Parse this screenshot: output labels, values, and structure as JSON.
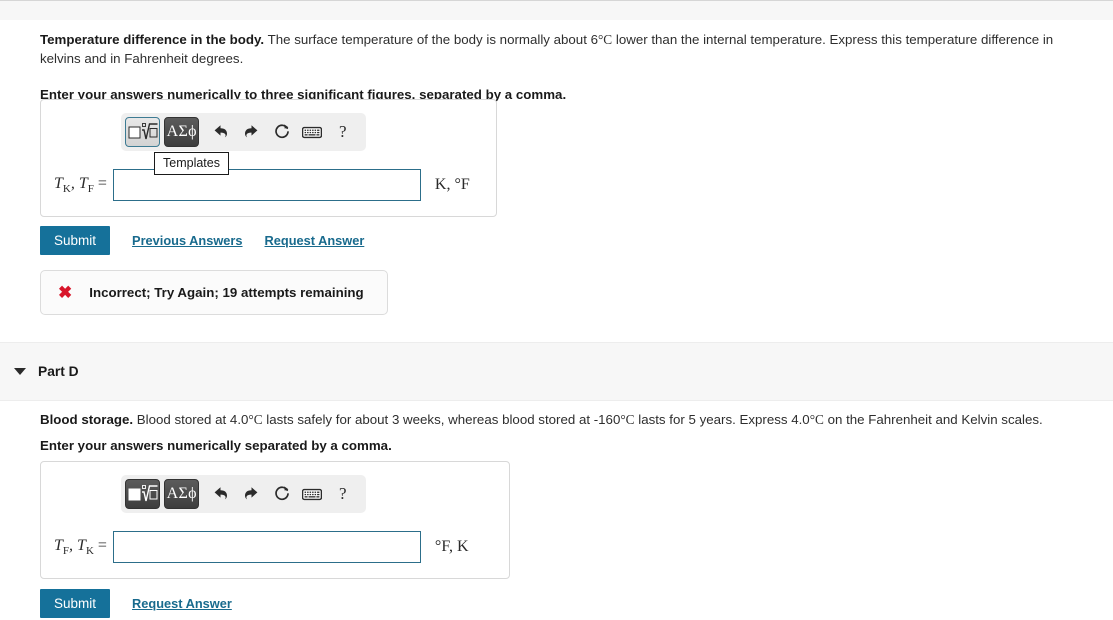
{
  "part_c": {
    "prompt_title": "Temperature difference in the body.",
    "prompt_text_1": "The surface temperature of the body is normally about 6",
    "prompt_deg_1": "°C",
    "prompt_text_2": " lower than the internal temperature. Express this temperature difference in kelvins and in Fahrenheit degrees.",
    "instruction": "Enter your answers numerically to three significant figures, separated by a comma.",
    "toolbar": {
      "templates_label": "templates-button",
      "greek_label": "ΑΣϕ",
      "undo_label": "undo",
      "redo_label": "redo",
      "reset_label": "reset",
      "keyboard_label": "keyboard",
      "help_label": "?"
    },
    "tooltip": "Templates",
    "answer_label_var1": "T",
    "answer_label_sub1": "K",
    "answer_label_var2": "T",
    "answer_label_sub2": "F",
    "answer_label_eq": "=",
    "answer_value": "",
    "answer_placeholder": "",
    "units": "K, °F",
    "submit_label": "Submit",
    "previous_answers_label": "Previous Answers",
    "request_answer_label": "Request Answer",
    "feedback_icon": "✖",
    "feedback_message": "Incorrect; Try Again; 19 attempts remaining"
  },
  "part_d": {
    "header_title": "Part D",
    "prompt_title": "Blood storage.",
    "prompt_text_1": "Blood stored at 4.0",
    "prompt_deg_1": "°C",
    "prompt_text_2": " lasts safely for about 3 weeks, whereas blood stored at -160",
    "prompt_deg_2": "°C",
    "prompt_text_3": " lasts for 5 years. Express 4.0",
    "prompt_deg_3": "°C",
    "prompt_text_4": " on the Fahrenheit and Kelvin scales.",
    "instruction": "Enter your answers numerically separated by a comma.",
    "toolbar": {
      "templates_label": "templates-button",
      "greek_label": "ΑΣϕ",
      "undo_label": "undo",
      "redo_label": "redo",
      "reset_label": "reset",
      "keyboard_label": "keyboard",
      "help_label": "?"
    },
    "answer_label_var1": "T",
    "answer_label_sub1": "F",
    "answer_label_var2": "T",
    "answer_label_sub2": "K",
    "answer_label_eq": "=",
    "answer_value": "",
    "answer_placeholder": "",
    "units": "°F, K",
    "submit_label": "Submit",
    "request_answer_label": "Request Answer"
  },
  "colors": {
    "accent": "#15719a",
    "link": "#186a8d",
    "error": "#d8152a",
    "input_border": "#2c6e8a",
    "band_bg": "#f7f7f7"
  }
}
